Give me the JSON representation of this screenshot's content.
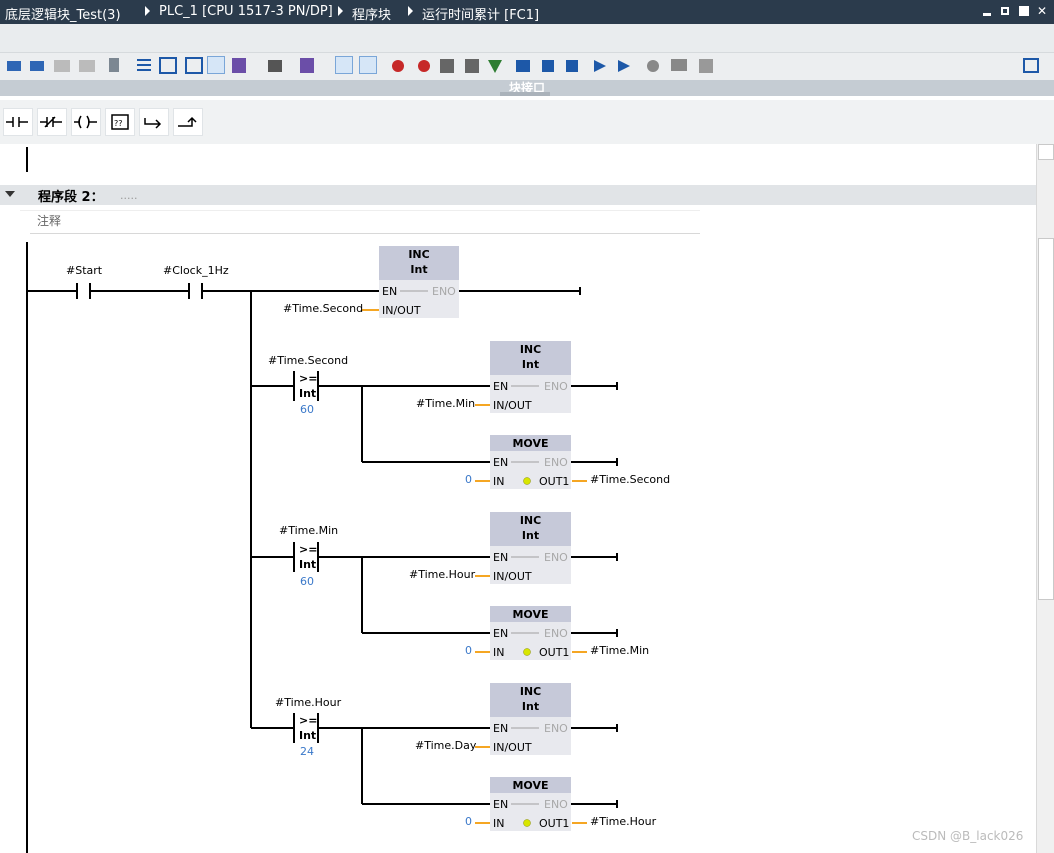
{
  "title": {
    "project": "底层逻辑块_Test(3)",
    "device": "PLC_1 [CPU 1517-3 PN/DP]",
    "folder": "程序块",
    "block": "运行时间累计 [FC1]"
  },
  "interface_bar": {
    "label": "块接口"
  },
  "network": {
    "label": "程序段 2：",
    "dots": ".....",
    "comment": "注释"
  },
  "contacts": {
    "start": "#Start",
    "clock": "#Clock_1Hz"
  },
  "boxes": {
    "inc_label": "INC",
    "move_label": "MOVE",
    "type_label": "Int",
    "en": "EN",
    "eno": "ENO",
    "in": "IN",
    "inout": "IN/OUT",
    "out1": "OUT1",
    "cmp": ">=",
    "move_in": "0"
  },
  "rungs": {
    "top": {
      "operand": "#Time.Second"
    },
    "seconds": {
      "cmp_operand": "#Time.Second",
      "cmp_value": "60",
      "inc_operand": "#Time.Min",
      "move_out": "#Time.Second"
    },
    "minutes": {
      "cmp_operand": "#Time.Min",
      "cmp_value": "60",
      "inc_operand": "#Time.Hour",
      "move_out": "#Time.Min"
    },
    "hours": {
      "cmp_operand": "#Time.Hour",
      "cmp_value": "24",
      "inc_operand": "#Time.Day",
      "move_out": "#Time.Hour"
    }
  },
  "watermark": "CSDN @B_lack026",
  "colors": {
    "titlebar": "#2b3b4c",
    "box_header": "#c6c9d9",
    "box_body": "#e8e9ee",
    "operand_line": "#f5a623",
    "constant": "#3a78c9"
  }
}
